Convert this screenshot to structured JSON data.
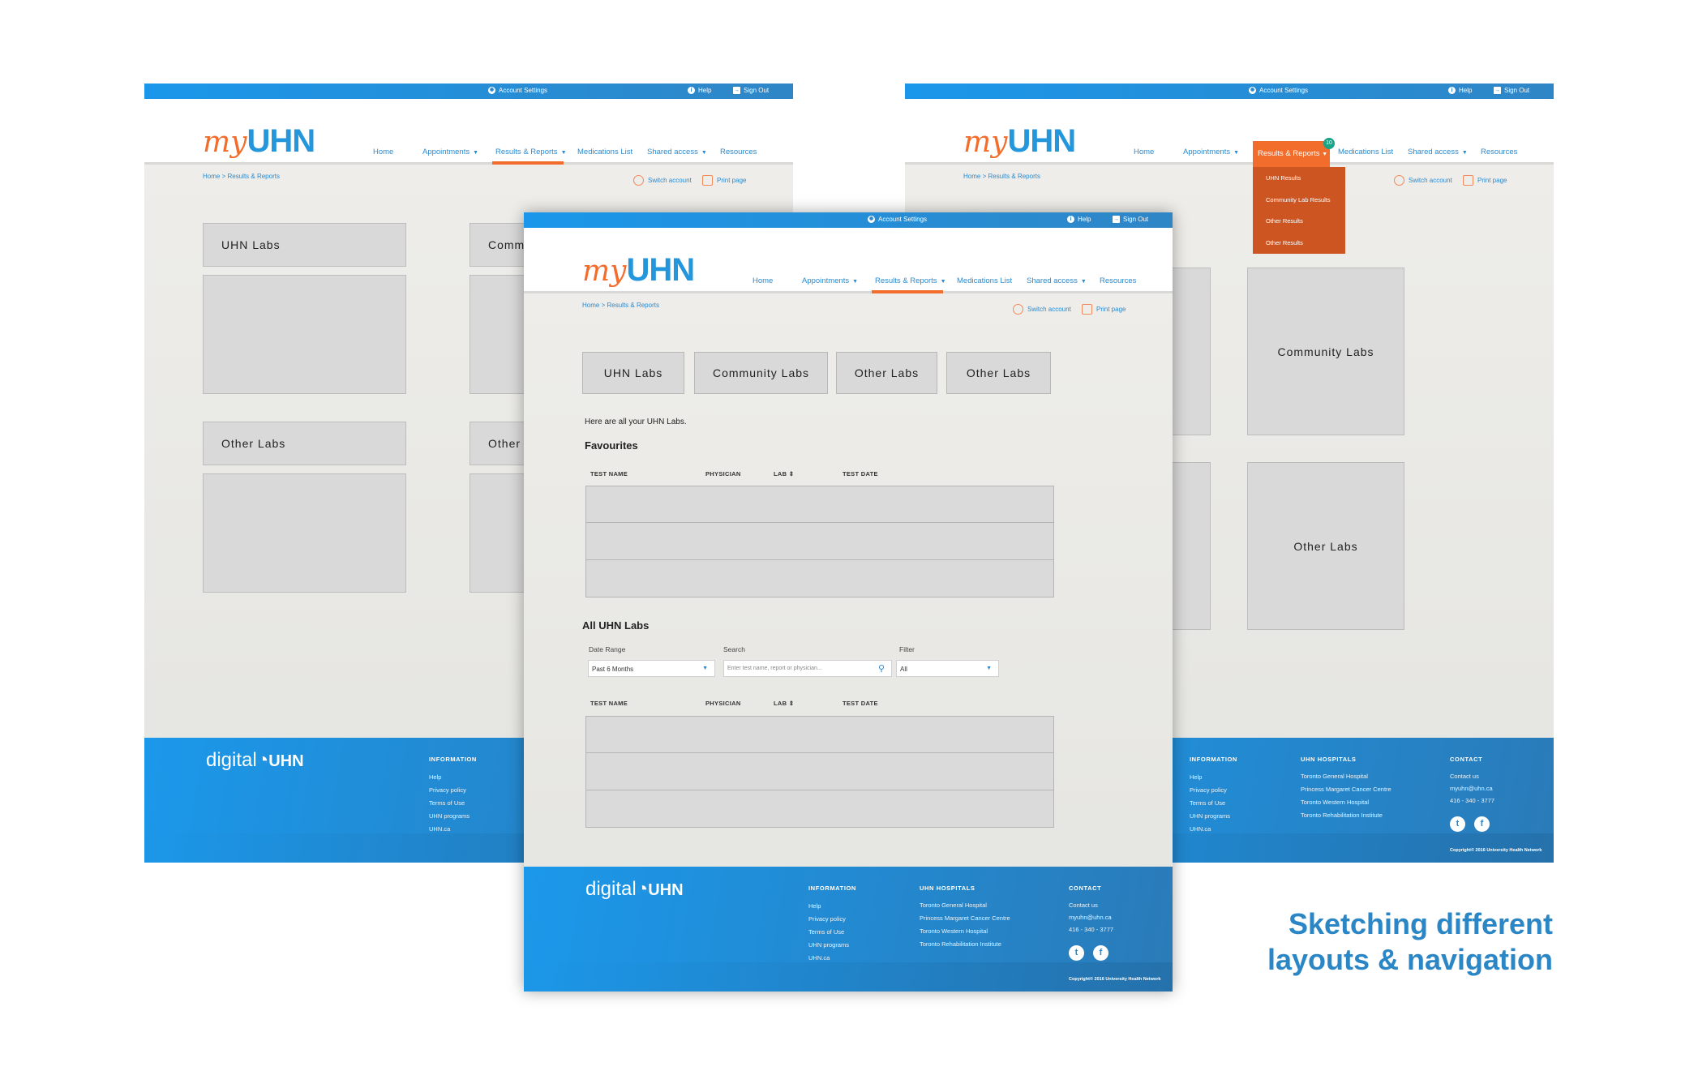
{
  "top_links": {
    "account_settings": "Account Settings",
    "help": "Help",
    "sign_out": "Sign Out"
  },
  "logo": {
    "my": "my",
    "uhn": "UHN"
  },
  "nav": {
    "home": "Home",
    "appointments": "Appointments",
    "results": "Results & Reports",
    "medications": "Medications List",
    "shared": "Shared access",
    "resources": "Resources",
    "dropdown_glyph": "▼"
  },
  "breadcrumb": {
    "home": "Home",
    "sep": ">",
    "current": "Results & Reports"
  },
  "utility": {
    "switch_account": "Switch account",
    "print_page": "Print page"
  },
  "left": {
    "boxes": [
      "UHN Labs",
      "Community Labs",
      "Other Labs",
      "Other Labs"
    ]
  },
  "right": {
    "badge": "10",
    "dropdown": [
      "UHN Results",
      "Community Lab Results",
      "Other Results",
      "Other Results"
    ],
    "boxes": [
      "Community Labs",
      "Other Labs"
    ]
  },
  "center": {
    "tabs": [
      "UHN Labs",
      "Community Labs",
      "Other Labs",
      "Other Labs"
    ],
    "intro": "Here are all your UHN Labs.",
    "favourites_title": "Favourites",
    "columns": [
      "TEST NAME",
      "PHYSICIAN",
      "LAB ⇕",
      "TEST DATE"
    ],
    "all_title": "All UHN Labs",
    "filters": {
      "date_label": "Date Range",
      "date_value": "Past 6 Months",
      "search_label": "Search",
      "search_placeholder": "Enter test name, report or physician...",
      "filter_label": "Filter",
      "filter_value": "All"
    }
  },
  "footer": {
    "logo_digital": "digital",
    "logo_uhn": "UHN",
    "information_title": "INFORMATION",
    "information": [
      "Help",
      "Privacy policy",
      "Terms of Use",
      "UHN programs",
      "UHN.ca"
    ],
    "hospitals_title": "UHN HOSPITALS",
    "hospitals": [
      "Toronto General Hospital",
      "Princess Margaret Cancer Centre",
      "Toronto Western Hospital",
      "Toronto Rehabilitation Institute"
    ],
    "contact_title": "CONTACT",
    "contact": [
      "Contact us",
      "myuhn@uhn.ca",
      "416 - 340 - 3777"
    ],
    "copyright": "Copyright© 2016 University Health Network"
  },
  "caption": {
    "line1": "Sketching different",
    "line2": "layouts & navigation"
  },
  "colors": {
    "brand_blue": "#2496dc",
    "brand_orange": "#f26d2c",
    "dropdown": "#cc5522",
    "badge": "#1aa386"
  }
}
